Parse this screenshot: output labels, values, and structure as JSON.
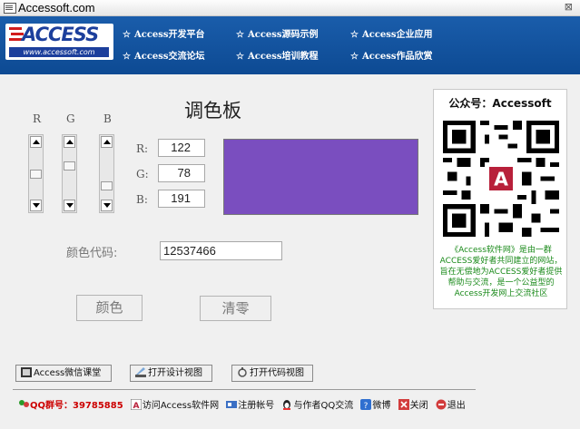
{
  "window": {
    "title": "Accessoft.com",
    "close_glyph": "⊠"
  },
  "banner": {
    "logo_text": "ACCESS",
    "logo_url": "www.accessoft.com",
    "links": [
      {
        "label": "Access开发平台"
      },
      {
        "label": "Access源码示例"
      },
      {
        "label": "Access企业应用"
      },
      {
        "label": "Access交流论坛"
      },
      {
        "label": "Access培训教程"
      },
      {
        "label": "Access作品欣赏"
      }
    ]
  },
  "palette": {
    "title": "调色板",
    "channel_headers": [
      "R",
      "G",
      "B"
    ],
    "fields": [
      {
        "label": "R:",
        "value": "122"
      },
      {
        "label": "G:",
        "value": "78"
      },
      {
        "label": "B:",
        "value": "191"
      }
    ],
    "swatch_color": "#7a4ebf",
    "scroll_levels": [
      0.48,
      0.31,
      0.75
    ],
    "code_label": "颜色代码:",
    "code_value": "12537466",
    "color_button": "颜色",
    "clear_button": "清零"
  },
  "qr_panel": {
    "title": "公众号：Accessoft",
    "description": "《Access软件网》是由一群ACCESS爱好者共同建立的网站，旨在无偿地为ACCESS爱好者提供帮助与交流，是一个公益型的Access开发网上交流社区"
  },
  "toolbar": {
    "wechat_class": "Access微信课堂",
    "design_view": "打开设计视图",
    "code_view": "打开代码视图"
  },
  "footer": {
    "qq_group": "QQ群号：39785885",
    "visit": "访问Access软件网",
    "register": "注册帐号",
    "contact_author": "与作者QQ交流",
    "weibo": "微博",
    "close": "关闭",
    "exit": "退出"
  },
  "colors": {
    "banner": "#0d4a93",
    "accent_green": "#1a8a1a",
    "qq_red": "#cc0000"
  }
}
